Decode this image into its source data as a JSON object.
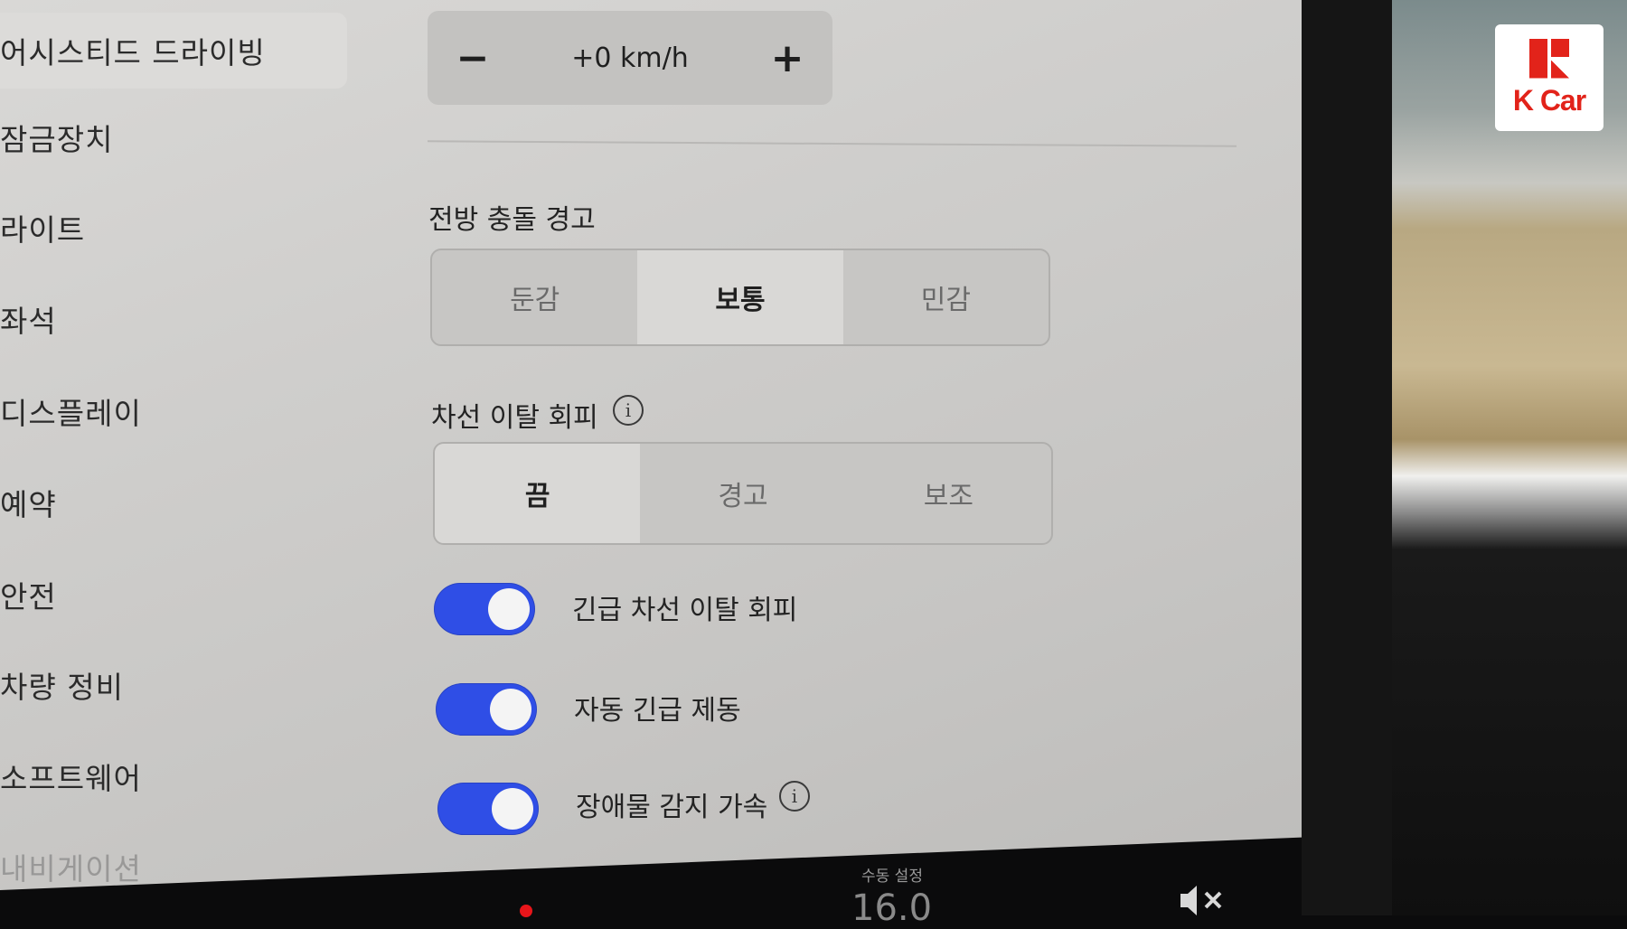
{
  "sidebar": {
    "items": [
      {
        "label": "어시스티드 드라이빙",
        "active": true
      },
      {
        "label": "잠금장치"
      },
      {
        "label": "라이트"
      },
      {
        "label": "좌석"
      },
      {
        "label": "디스플레이"
      },
      {
        "label": "예약"
      },
      {
        "label": "안전"
      },
      {
        "label": "차량 정비"
      },
      {
        "label": "소프트웨어"
      },
      {
        "label": "내비게이션"
      }
    ]
  },
  "speed_offset": {
    "minus": "−",
    "value": "+0 km/h",
    "plus": "+"
  },
  "forward_collision": {
    "title": "전방 충돌 경고",
    "options": [
      "둔감",
      "보통",
      "민감"
    ],
    "selected": "보통"
  },
  "lane_departure": {
    "title": "차선 이탈 회피",
    "info_icon": "info-icon",
    "options": [
      "끔",
      "경고",
      "보조"
    ],
    "selected": "끔"
  },
  "toggles": [
    {
      "label": "긴급 차선 이탈 회피",
      "on": true
    },
    {
      "label": "자동 긴급 제동",
      "on": true
    },
    {
      "label": "장애물 감지 가속",
      "on": true,
      "info_icon": "info-icon"
    }
  ],
  "bottom_bar": {
    "climate_label": "수동 설정",
    "temperature": "16.0"
  },
  "watermark": {
    "brand": "K Car"
  },
  "colors": {
    "toggle_on": "#2f4ee6",
    "brand_red": "#e2231a"
  }
}
